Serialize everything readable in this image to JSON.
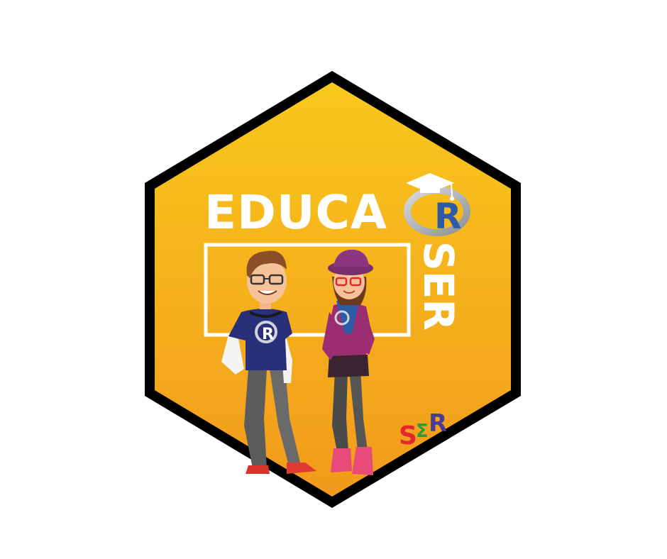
{
  "badge": {
    "title_word": "EDUCA",
    "r_letter": "R",
    "vertical_word": "SER",
    "shirt_letter": "R",
    "ser_logo": {
      "s": "S",
      "sigma": "Σ",
      "r": "R"
    }
  },
  "colors": {
    "background": "#ffffff",
    "hex_border": "#000000",
    "hex_fill_top": "#f7c21a",
    "hex_fill_bottom": "#f29a1c",
    "text": "#ffffff",
    "r_blue": "#2c5ba8",
    "ser_s": "#e0282e",
    "ser_sigma": "#2e9b3a",
    "ser_r": "#4a3b93"
  },
  "icons": [
    "graduation-cap-icon",
    "r-logo-icon",
    "ser-logo-icon"
  ]
}
